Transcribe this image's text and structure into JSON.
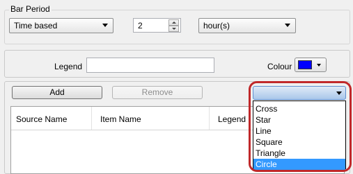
{
  "bar_period": {
    "group_label": "Bar Period",
    "mode_value": "Time based",
    "count_value": "2",
    "unit_value": "hour(s)"
  },
  "legend_row": {
    "legend_label": "Legend",
    "legend_value": "",
    "colour_label": "Colour",
    "colour_value": "#0000ff"
  },
  "actions": {
    "add_label": "Add",
    "remove_label": "Remove"
  },
  "table": {
    "columns": [
      "Source Name",
      "Item Name",
      "Legend"
    ]
  },
  "marker_dropdown": {
    "options": [
      "Cross",
      "Star",
      "Line",
      "Square",
      "Triangle",
      "Circle"
    ],
    "highlighted": "Circle",
    "callout_color": "#c0282a"
  }
}
